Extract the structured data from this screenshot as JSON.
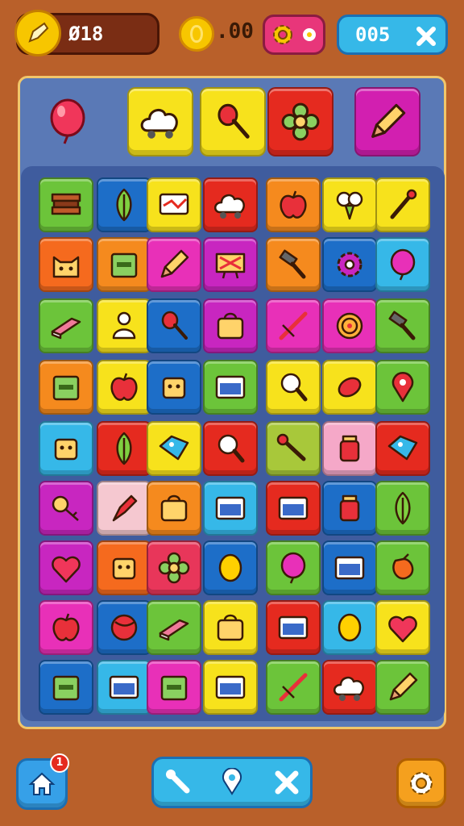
{
  "hud": {
    "score_label": "Ø18",
    "coins_label": ".00",
    "level_label": "005"
  },
  "icons": {
    "score": "pencil-icon",
    "coins": "coin-icon",
    "settings": "gear-icon",
    "close": "close-icon",
    "home": "home-icon",
    "hint": "wrench-icon",
    "location": "pin-icon",
    "shuffle": "cross-icon",
    "options": "gear-icon"
  },
  "notification_count": "1",
  "target_items": [
    {
      "icon": "balloon-icon",
      "color": "#5a79b6"
    },
    {
      "icon": "cloud-icon",
      "color": "#f7e21c"
    },
    {
      "icon": "spoon-icon",
      "color": "#f7e21c"
    },
    {
      "icon": "flower-icon",
      "color": "#e52a1f"
    },
    {
      "icon": "pencil-icon",
      "color": "#d21fb0"
    }
  ],
  "grid": [
    [
      {
        "c": "#6cc43a",
        "i": "book-icon"
      },
      {
        "c": "#1d6ec8",
        "i": "leaf-icon"
      },
      {
        "c": "#f7e21c",
        "i": "flag-icon"
      },
      {
        "c": "#e52a1f",
        "i": "cloud-icon"
      },
      {
        "c": "#f58a1e",
        "i": "apple-icon"
      },
      {
        "c": "#f7e21c",
        "i": "broccoli-icon"
      },
      {
        "c": "#f7e21c",
        "i": "stick-icon"
      }
    ],
    [
      {
        "c": "#f56a1e",
        "i": "cat-icon"
      },
      {
        "c": "#f58a1e",
        "i": "box-icon"
      },
      {
        "c": "#e830b8",
        "i": "pencil-icon"
      },
      {
        "c": "#c826c0",
        "i": "sign-icon"
      },
      {
        "c": "#f58a1e",
        "i": "hammer-icon"
      },
      {
        "c": "#1d6ec8",
        "i": "gear-icon"
      },
      {
        "c": "#36b8e8",
        "i": "balloon-icon"
      }
    ],
    [
      {
        "c": "#6cc43a",
        "i": "eraser-icon"
      },
      {
        "c": "#f7e21c",
        "i": "person-icon"
      },
      {
        "c": "#1d6ec8",
        "i": "spoon-icon"
      },
      {
        "c": "#c826c0",
        "i": "bag-icon"
      },
      {
        "c": "#e830b8",
        "i": "sword-icon"
      },
      {
        "c": "#e830b8",
        "i": "spiral-icon"
      },
      {
        "c": "#6cc43a",
        "i": "hammer-icon"
      }
    ],
    [
      {
        "c": "#f58a1e",
        "i": "box-icon"
      },
      {
        "c": "#f7e21c",
        "i": "apple-icon"
      },
      {
        "c": "#1d6ec8",
        "i": "robot-icon"
      },
      {
        "c": "#6cc43a",
        "i": "window-icon"
      },
      {
        "c": "#f7e21c",
        "i": "magnifier-icon"
      },
      {
        "c": "#f7e21c",
        "i": "seed-icon"
      },
      {
        "c": "#6cc43a",
        "i": "pin-icon"
      }
    ],
    [
      {
        "c": "#36b8e8",
        "i": "robot-icon"
      },
      {
        "c": "#e52a1f",
        "i": "leaf-icon"
      },
      {
        "c": "#f7e21c",
        "i": "tag-icon"
      },
      {
        "c": "#e52a1f",
        "i": "magnifier-icon"
      },
      {
        "c": "#a8c83a",
        "i": "wrench-icon"
      },
      {
        "c": "#f5a8c8",
        "i": "jar-icon"
      },
      {
        "c": "#e52a1f",
        "i": "tag-icon"
      }
    ],
    [
      {
        "c": "#c826c0",
        "i": "key-icon"
      },
      {
        "c": "#f5c8d0",
        "i": "brush-icon"
      },
      {
        "c": "#f58a1e",
        "i": "bag-icon"
      },
      {
        "c": "#36b8e8",
        "i": "window-icon"
      },
      {
        "c": "#e52a1f",
        "i": "window-icon"
      },
      {
        "c": "#1d6ec8",
        "i": "jar-icon"
      },
      {
        "c": "#6cc43a",
        "i": "leaf-icon"
      }
    ],
    [
      {
        "c": "#c826c0",
        "i": "heart-icon"
      },
      {
        "c": "#f56a1e",
        "i": "robot-icon"
      },
      {
        "c": "#e8365a",
        "i": "flower-icon"
      },
      {
        "c": "#1d6ec8",
        "i": "egg-icon"
      },
      {
        "c": "#6cc43a",
        "i": "balloon-icon"
      },
      {
        "c": "#1d6ec8",
        "i": "window-icon"
      },
      {
        "c": "#6cc43a",
        "i": "pepper-icon"
      }
    ],
    [
      {
        "c": "#e830b8",
        "i": "apple-icon"
      },
      {
        "c": "#1d6ec8",
        "i": "ball-icon"
      },
      {
        "c": "#6cc43a",
        "i": "eraser-icon"
      },
      {
        "c": "#f7e21c",
        "i": "bag-icon"
      },
      {
        "c": "#e52a1f",
        "i": "window-icon"
      },
      {
        "c": "#36b8e8",
        "i": "egg-icon"
      },
      {
        "c": "#f7e21c",
        "i": "heart-icon"
      }
    ],
    [
      {
        "c": "#1d6ec8",
        "i": "box-icon"
      },
      {
        "c": "#36b8e8",
        "i": "window-icon"
      },
      {
        "c": "#e830b8",
        "i": "box-icon"
      },
      {
        "c": "#f7e21c",
        "i": "window-icon"
      },
      {
        "c": "#6cc43a",
        "i": "sword-icon"
      },
      {
        "c": "#e52a1f",
        "i": "cloud-icon"
      },
      {
        "c": "#6cc43a",
        "i": "pencil-icon"
      }
    ]
  ]
}
